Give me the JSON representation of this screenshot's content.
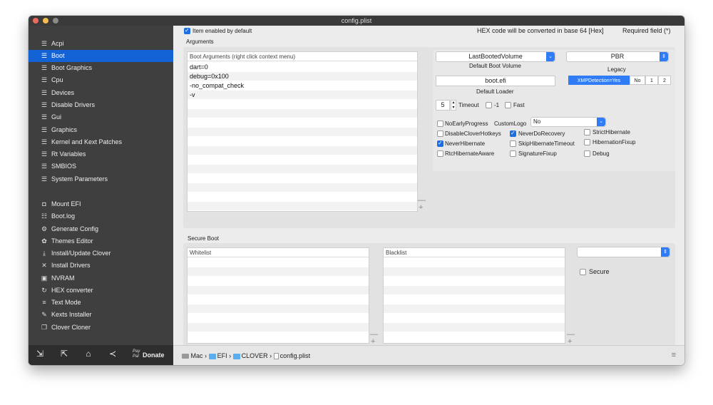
{
  "window": {
    "title": "config.plist"
  },
  "sidebar": {
    "items": [
      {
        "label": "Acpi",
        "icon": "list-icon"
      },
      {
        "label": "Boot",
        "icon": "list-icon"
      },
      {
        "label": "Boot Graphics",
        "icon": "list-icon"
      },
      {
        "label": "Cpu",
        "icon": "list-icon"
      },
      {
        "label": "Devices",
        "icon": "list-icon"
      },
      {
        "label": "Disable Drivers",
        "icon": "list-icon"
      },
      {
        "label": "Gui",
        "icon": "list-icon"
      },
      {
        "label": "Graphics",
        "icon": "list-icon"
      },
      {
        "label": "Kernel and Kext Patches",
        "icon": "list-icon"
      },
      {
        "label": "Rt Variables",
        "icon": "list-icon"
      },
      {
        "label": "SMBIOS",
        "icon": "list-icon"
      },
      {
        "label": "System Parameters",
        "icon": "list-icon"
      }
    ],
    "selected": "Boot",
    "tools": [
      {
        "label": "Mount EFI",
        "icon": "disk-icon"
      },
      {
        "label": "Boot.log",
        "icon": "log-icon"
      },
      {
        "label": "Generate Config",
        "icon": "gears-icon"
      },
      {
        "label": "Themes Editor",
        "icon": "palette-icon"
      },
      {
        "label": "Install/Update Clover",
        "icon": "download-icon"
      },
      {
        "label": "Install Drivers",
        "icon": "tools-icon"
      },
      {
        "label": "NVRAM",
        "icon": "chip-icon"
      },
      {
        "label": "HEX converter",
        "icon": "refresh-icon"
      },
      {
        "label": "Text Mode",
        "icon": "text-icon"
      },
      {
        "label": "Kexts Installer",
        "icon": "wrench-icon"
      },
      {
        "label": "Clover Cloner",
        "icon": "clone-icon"
      }
    ],
    "bottom": {
      "donate_label": "Donate",
      "paypal_label": "Pay Pal"
    }
  },
  "main": {
    "item_enabled_label": "Item enabled by default",
    "hex_note": "HEX code will be converted in base 64 [Hex]",
    "required_note": "Required field (*)",
    "arguments_title": "Arguments",
    "boot_args_header": "Boot Arguments (right click context menu)",
    "boot_args": [
      "dart=0",
      "debug=0x100",
      "-no_compat_check",
      "-v"
    ],
    "default_volume": {
      "value": "LastBootedVolume",
      "label": "Default Boot Volume"
    },
    "legacy": {
      "value": "PBR",
      "label": "Legacy"
    },
    "default_loader": {
      "value": "boot.efi",
      "label": "Default Loader"
    },
    "xmp": {
      "options": [
        "XMPDetection=Yes",
        "No",
        "1",
        "2"
      ],
      "selected": "XMPDetection=Yes"
    },
    "timeout": {
      "value": "5",
      "label": "Timeout"
    },
    "minus_one_label": "-1",
    "fast_label": "Fast",
    "custom_logo": {
      "label": "CustomLogo",
      "value": "No"
    },
    "checks": [
      {
        "label": "NoEarlyProgress",
        "checked": false
      },
      {
        "label": "DisableCloverHotkeys",
        "checked": false
      },
      {
        "label": "NeverDoRecovery",
        "checked": true
      },
      {
        "label": "StrictHibernate",
        "checked": false
      },
      {
        "label": "NeverHibernate",
        "checked": true
      },
      {
        "label": "SkipHibernateTimeout",
        "checked": false
      },
      {
        "label": "HibernationFixup",
        "checked": false
      },
      {
        "label": "RtcHibernateAware",
        "checked": false
      },
      {
        "label": "SignatureFixup",
        "checked": false
      },
      {
        "label": "Debug",
        "checked": false
      }
    ],
    "secure_boot_title": "Secure Boot",
    "whitelist_header": "Whitelist",
    "blacklist_header": "Blacklist",
    "secure_label": "Secure",
    "add_symbol": "+",
    "remove_symbol": "—"
  },
  "status": {
    "path": [
      "Mac",
      "EFI",
      "CLOVER",
      "config.plist"
    ],
    "separator": "›"
  },
  "colors": {
    "accent": "#1363d7",
    "sidebar_bg": "#3f3f3f"
  }
}
